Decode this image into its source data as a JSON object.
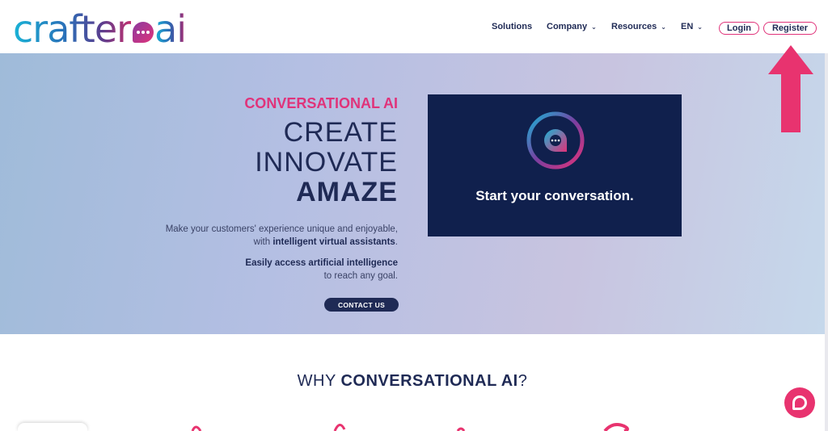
{
  "brand": {
    "name_part1": "crafter",
    "name_part2": "ai"
  },
  "nav": {
    "solutions": "Solutions",
    "company": "Company",
    "resources": "Resources",
    "language": "EN",
    "chevron": "⌄",
    "login": "Login",
    "register": "Register"
  },
  "hero": {
    "eyebrow": "CONVERSATIONAL AI",
    "line1": "CREATE",
    "line2": "INNOVATE",
    "line3": "AMAZE",
    "desc_line1": "Make your customers' experience unique and enjoyable,",
    "desc_line2_prefix": "with ",
    "desc_line2_bold": "intelligent virtual assistants",
    "desc_line2_suffix": ".",
    "desc2_bold": "Easily access artificial intelligence",
    "desc2_line2": "to reach any goal.",
    "cta": "CONTACT US"
  },
  "video_card": {
    "title": "Start your conversation."
  },
  "why": {
    "prefix": "WHY ",
    "bold": "CONVERSATIONAL AI",
    "suffix": "?"
  },
  "icons": {
    "register_arrow": "arrow-up-icon",
    "chat_widget": "chat-bubble-icon"
  },
  "colors": {
    "accent_pink": "#e0337a",
    "navy": "#1f2a55",
    "card_navy": "#10204d"
  }
}
